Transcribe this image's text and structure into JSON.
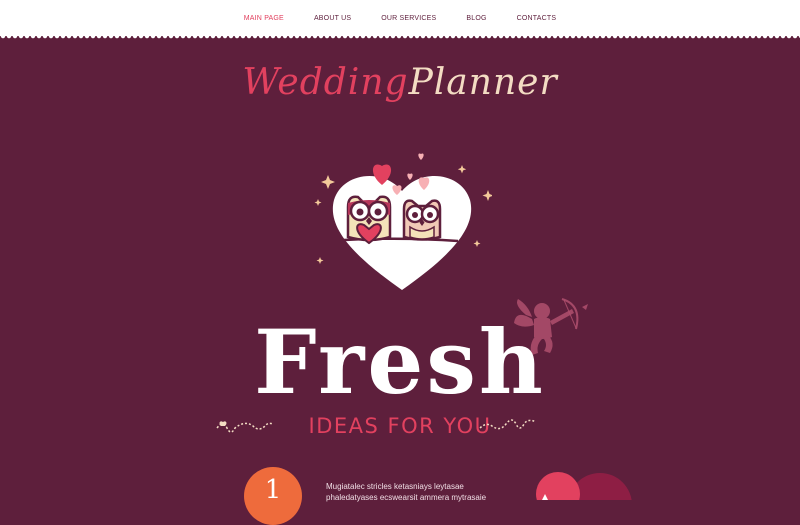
{
  "nav": {
    "items": [
      {
        "label": "MAIN PAGE",
        "active": true
      },
      {
        "label": "ABOUT US",
        "active": false
      },
      {
        "label": "OUR SERVICES",
        "active": false
      },
      {
        "label": "BLOG",
        "active": false
      },
      {
        "label": "CONTACTS",
        "active": false
      }
    ]
  },
  "logo": {
    "word1": "Wedding",
    "word2": "Planner"
  },
  "hero": {
    "title": "Fresh",
    "tagline": "IDEAS FOR YOU"
  },
  "intro": {
    "step_number": "1",
    "text": "Mugiatalec stricles ketasniays leytasae phaledatyases ecswearsit ammera mytrasaie"
  },
  "colors": {
    "background": "#5e1f3c",
    "accent": "#e2415f",
    "cream": "#f3dcc3",
    "step_circle": "#ee6b3c",
    "topbar": "#ffffff"
  },
  "icons": {
    "hero": "owls-in-heart-icon",
    "cupid": "cupid-icon",
    "swirls": "swirl-ornament-icon",
    "footer_hearts": "hearts-icon"
  }
}
